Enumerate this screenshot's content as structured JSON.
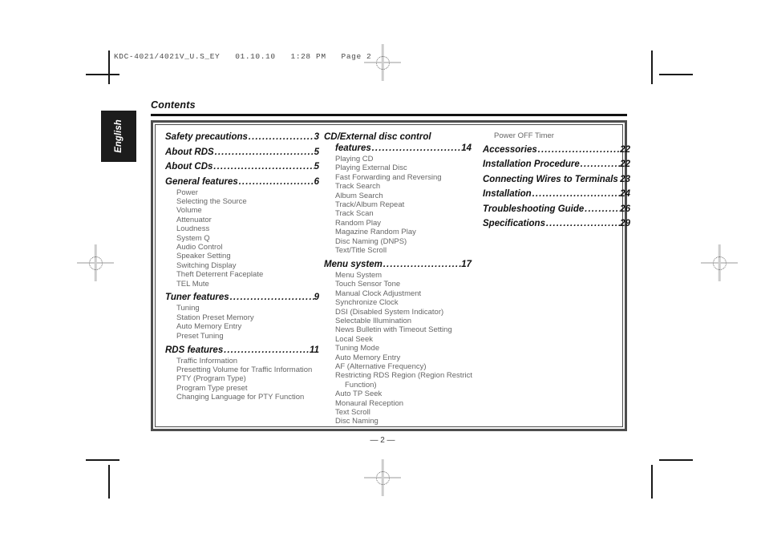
{
  "document": {
    "file_header": "KDC-4021/4021V_U.S_EY   01.10.10   1:28 PM   Page 2",
    "language_tab": "English",
    "page_title": "Contents",
    "page_number": "— 2 —"
  },
  "toc": {
    "columns": [
      {
        "id": "left",
        "entries": [
          {
            "type": "chapter",
            "label": "Safety precautions",
            "page": "3",
            "leader": "......................."
          },
          {
            "type": "chapter",
            "label": "About RDS ",
            "page": "5",
            "leader": "................................"
          },
          {
            "type": "chapter",
            "label": "About CDs",
            "page": "5",
            "leader": "................................."
          },
          {
            "type": "chapter",
            "label": "General features ",
            "page": "6",
            "leader": "..........................."
          },
          {
            "type": "sub",
            "label": "Power"
          },
          {
            "type": "sub",
            "label": "Selecting the Source"
          },
          {
            "type": "sub",
            "label": "Volume"
          },
          {
            "type": "sub",
            "label": "Attenuator"
          },
          {
            "type": "sub",
            "label": "Loudness"
          },
          {
            "type": "sub",
            "label": "System Q"
          },
          {
            "type": "sub",
            "label": "Audio Control"
          },
          {
            "type": "sub",
            "label": "Speaker Setting"
          },
          {
            "type": "sub",
            "label": "Switching Display"
          },
          {
            "type": "sub",
            "label": "Theft Deterrent Faceplate"
          },
          {
            "type": "sub",
            "label": "TEL Mute"
          },
          {
            "type": "chapter",
            "label": "Tuner features ",
            "page": "9",
            "leader": ".............................."
          },
          {
            "type": "sub",
            "label": "Tuning"
          },
          {
            "type": "sub",
            "label": "Station Preset Memory"
          },
          {
            "type": "sub",
            "label": "Auto Memory Entry"
          },
          {
            "type": "sub",
            "label": "Preset Tuning"
          },
          {
            "type": "chapter",
            "label": "RDS features ",
            "page": "11",
            "leader": "............................."
          },
          {
            "type": "sub",
            "label": "Traffic Information"
          },
          {
            "type": "sub",
            "label": "Presetting Volume for Traffic Information"
          },
          {
            "type": "sub",
            "label": "PTY (Program Type)"
          },
          {
            "type": "sub",
            "label": "Program Type preset"
          },
          {
            "type": "sub",
            "label": "Changing Language for PTY Function"
          }
        ]
      },
      {
        "id": "middle",
        "entries": [
          {
            "type": "chapter-wrap",
            "line1": "CD/External disc control",
            "label": "features ",
            "page": "14",
            "leader": "................................."
          },
          {
            "type": "sub",
            "label": "Playing CD"
          },
          {
            "type": "sub",
            "label": "Playing External Disc"
          },
          {
            "type": "sub",
            "label": "Fast Forwarding and Reversing"
          },
          {
            "type": "sub",
            "label": "Track Search"
          },
          {
            "type": "sub",
            "label": "Album Search"
          },
          {
            "type": "sub",
            "label": "Track/Album Repeat"
          },
          {
            "type": "sub",
            "label": "Track Scan"
          },
          {
            "type": "sub",
            "label": "Random Play"
          },
          {
            "type": "sub",
            "label": "Magazine Random Play"
          },
          {
            "type": "sub",
            "label": "Disc Naming (DNPS)"
          },
          {
            "type": "sub",
            "label": "Text/Title Scroll"
          },
          {
            "type": "chapter",
            "label": "Menu system",
            "page": "17",
            "leader": "............................."
          },
          {
            "type": "sub",
            "label": "Menu System"
          },
          {
            "type": "sub",
            "label": "Touch Sensor Tone"
          },
          {
            "type": "sub",
            "label": "Manual Clock Adjustment"
          },
          {
            "type": "sub",
            "label": "Synchronize Clock"
          },
          {
            "type": "sub",
            "label": "DSI (Disabled System Indicator)"
          },
          {
            "type": "sub",
            "label": "Selectable Illumination"
          },
          {
            "type": "sub",
            "label": "News Bulletin with Timeout Setting"
          },
          {
            "type": "sub",
            "label": "Local Seek"
          },
          {
            "type": "sub",
            "label": "Tuning Mode"
          },
          {
            "type": "sub",
            "label": "Auto Memory Entry"
          },
          {
            "type": "sub",
            "label": "AF (Alternative Frequency)"
          },
          {
            "type": "sub",
            "label": "Restricting RDS Region (Region Restrict"
          },
          {
            "type": "sub-cont",
            "label": "Function)"
          },
          {
            "type": "sub",
            "label": "Auto TP Seek"
          },
          {
            "type": "sub",
            "label": "Monaural Reception"
          },
          {
            "type": "sub",
            "label": "Text Scroll"
          },
          {
            "type": "sub",
            "label": "Disc Naming"
          }
        ]
      },
      {
        "id": "right",
        "entries": [
          {
            "type": "sub",
            "label": "Power OFF Timer"
          },
          {
            "type": "chapter",
            "label": "Accessories ",
            "page": "22",
            "leader": "............................."
          },
          {
            "type": "chapter",
            "label": "Installation Procedure ",
            "page": "22",
            "leader": "..............."
          },
          {
            "type": "chapter",
            "label": "Connecting Wires to Terminals ",
            "page": "23",
            "leader": ""
          },
          {
            "type": "chapter",
            "label": "Installation ",
            "page": "24",
            "leader": "................................"
          },
          {
            "type": "chapter",
            "label": "Troubleshooting Guide ",
            "page": "26",
            "leader": ".............."
          },
          {
            "type": "chapter",
            "label": "Specifications ",
            "page": "29",
            "leader": "..........................."
          }
        ]
      }
    ]
  }
}
